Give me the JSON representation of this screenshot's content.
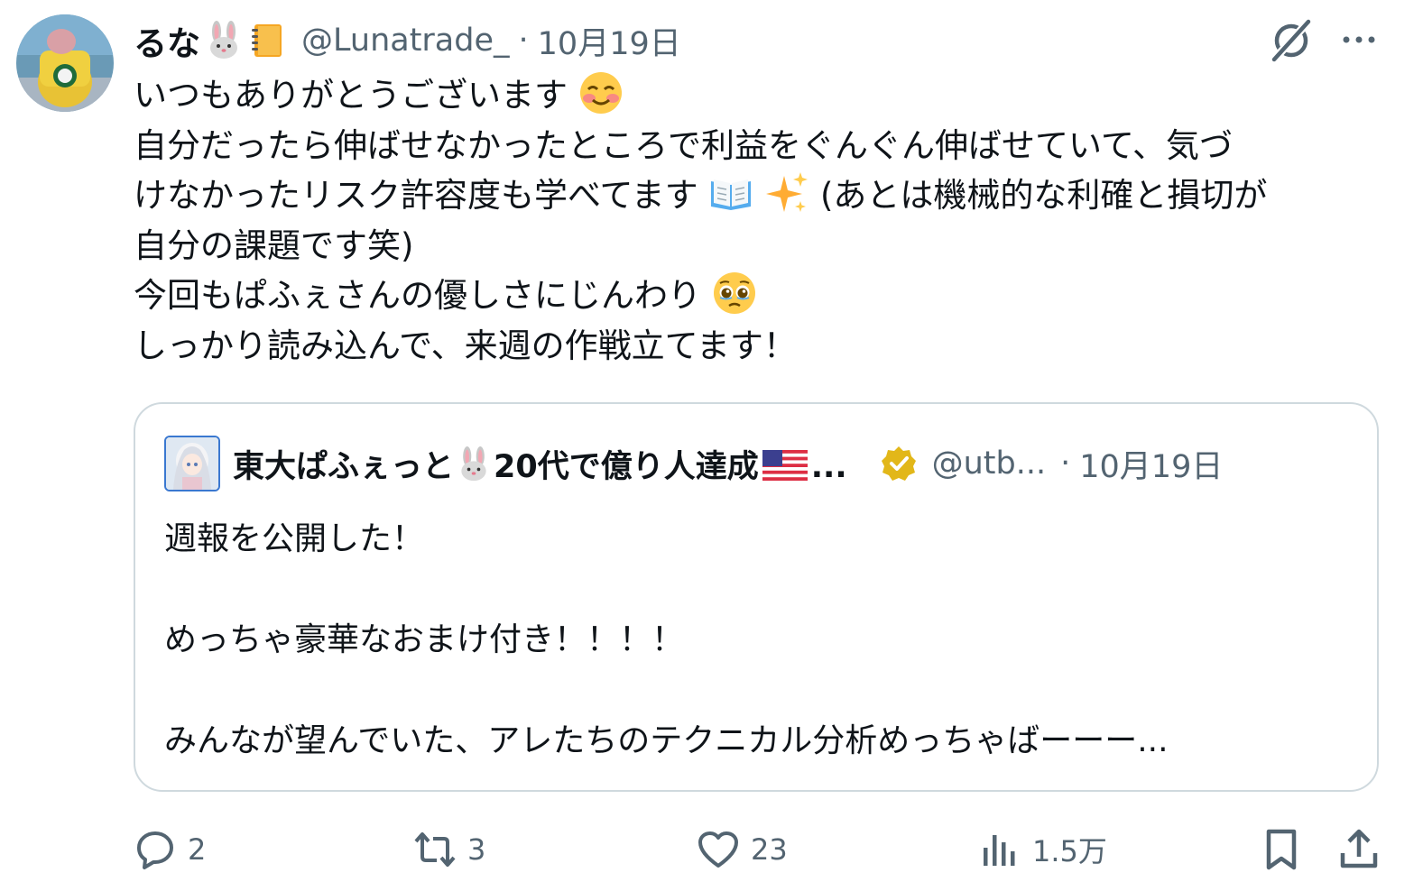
{
  "tweet": {
    "author_name": "るな",
    "author_name_emojis": [
      "rabbit-face-emoji",
      "notebook-emoji"
    ],
    "handle": "@Lunatrade_",
    "separator": "·",
    "date": "10月19日",
    "lines": [
      {
        "text": "いつもありがとうございます",
        "emoji": "smiling-face-emoji"
      },
      {
        "text": "自分だったら伸ばせなかったところで利益をぐんぐん伸ばせていて、気づ"
      },
      {
        "text_before": "けなかったリスク許容度も学べてます",
        "emojis": [
          "open-book-emoji",
          "sparkles-emoji"
        ],
        "text_after": "(あとは機械的な利確と損切が"
      },
      {
        "text": "自分の課題です笑)"
      },
      {
        "text": "今回もぱふぇさんの優しさにじんわり",
        "emoji": "pleading-face-emoji"
      },
      {
        "text": "しっかり読み込んで、来週の作戦立てます！"
      }
    ]
  },
  "quote": {
    "author_name_prefix": "東大ぱふぇっと",
    "author_name_suffix": "20代で億り人達成",
    "author_name_ellipsis": "...",
    "name_emojis": [
      "rabbit-face-emoji",
      "us-flag-emoji"
    ],
    "verified": true,
    "handle": "@utb...",
    "separator": "·",
    "date": "10月19日",
    "lines": [
      "週報を公開した！",
      "",
      "めっちゃ豪華なおまけ付き！！！！",
      "",
      "みんなが望んでいた、アレたちのテクニカル分析めっちゃばーーー..."
    ]
  },
  "actions": {
    "reply_count": "2",
    "retweet_count": "3",
    "like_count": "23",
    "views_count": "1.5万"
  },
  "colors": {
    "text": "#0f1419",
    "secondary": "#536471",
    "border": "#cfd9de",
    "verified_gold": "#e2b719"
  }
}
